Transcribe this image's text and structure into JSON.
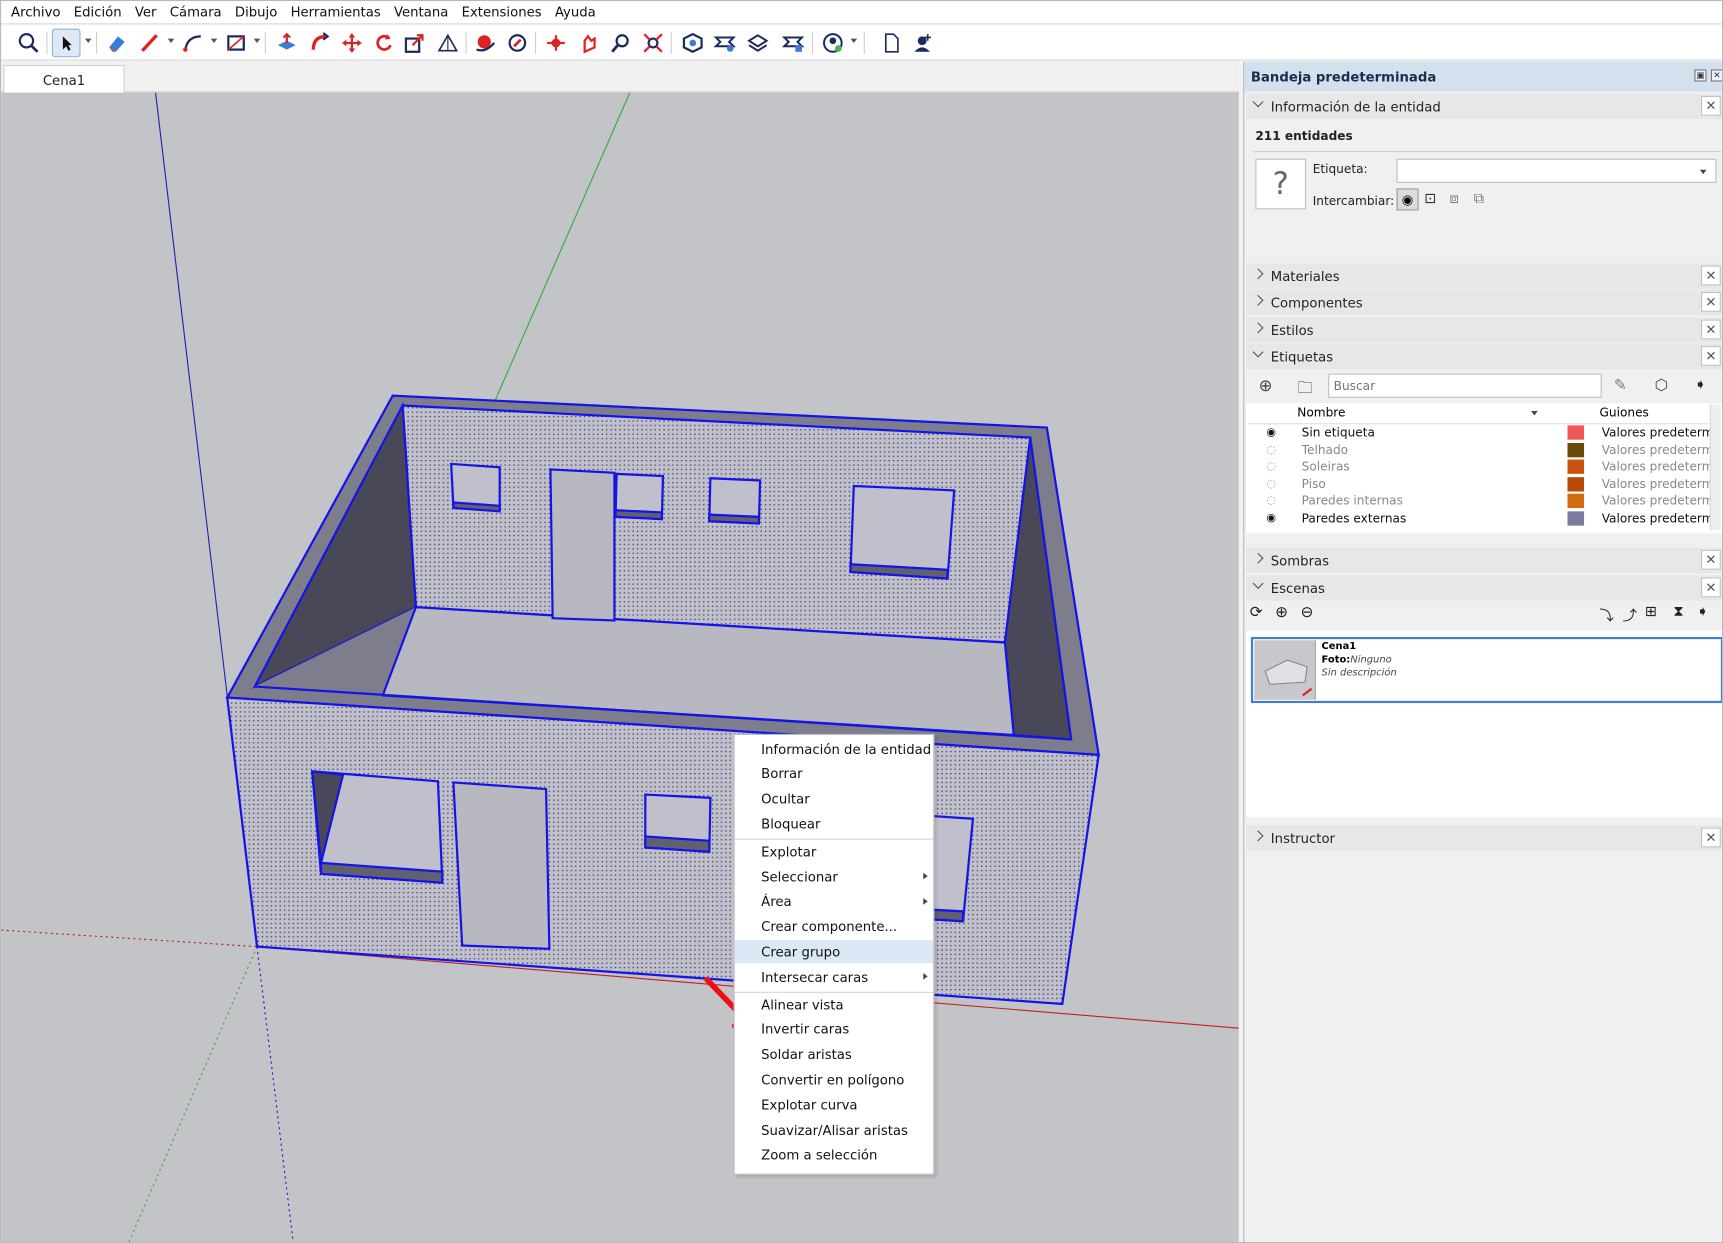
{
  "menu": [
    "Archivo",
    "Edición",
    "Ver",
    "Cámara",
    "Dibujo",
    "Herramientas",
    "Ventana",
    "Extensiones",
    "Ayuda"
  ],
  "toolbar_icons": [
    "zoom-icon",
    "select-arrow-icon",
    "eraser-icon",
    "pencil-line-icon",
    "arc-icon",
    "rectangle-icon",
    "push-pull-icon",
    "follow-me-icon",
    "move-icon",
    "rotate-icon",
    "scale-icon",
    "protractor-icon",
    "orbit-icon",
    "pan-icon",
    "zoom-window-icon",
    "zoom-extents-icon",
    "walk-icon",
    "look-around-icon",
    "section-plane-icon",
    "components-icon",
    "warehouse-icon",
    "extension-icon",
    "profile-icon",
    "new-file-icon",
    "add-user-icon"
  ],
  "scene_tab": "Cena1",
  "context_menu": {
    "items": [
      {
        "label": "Información de la entidad"
      },
      {
        "label": "Borrar"
      },
      {
        "label": "Ocultar"
      },
      {
        "label": "Bloquear"
      },
      {
        "label": "Explotar"
      },
      {
        "label": "Seleccionar",
        "submenu": true
      },
      {
        "label": "Área",
        "submenu": true
      },
      {
        "label": "Crear componente..."
      },
      {
        "label": "Crear grupo",
        "highlighted": true
      },
      {
        "label": "Intersecar caras",
        "submenu": true
      },
      {
        "label": "Alinear vista"
      },
      {
        "label": "Invertir caras"
      },
      {
        "label": "Soldar aristas"
      },
      {
        "label": "Convertir en polígono"
      },
      {
        "label": "Explotar curva"
      },
      {
        "label": "Suavizar/Alisar aristas"
      },
      {
        "label": "Zoom a selección"
      }
    ]
  },
  "tray": {
    "title": "Bandeja predeterminada",
    "entity_info": {
      "header": "Información de la entidad",
      "count": "211 entidades",
      "tag_label": "Etiqueta:",
      "toggle_label": "Intercambiar:",
      "unknown_glyph": "?"
    },
    "sections": {
      "materiales": "Materiales",
      "componentes": "Componentes",
      "estilos": "Estilos",
      "etiquetas": "Etiquetas",
      "sombras": "Sombras",
      "escenas": "Escenas",
      "instructor": "Instructor"
    },
    "tags": {
      "search_placeholder": "Buscar",
      "col_name": "Nombre",
      "col_dashes": "Guiones",
      "rows": [
        {
          "name": "Sin etiqueta",
          "visible": true,
          "color": "#f05858",
          "dashes": "Valores predeterminados"
        },
        {
          "name": "Telhado",
          "visible": false,
          "color": "#6b4a08",
          "dashes": "Valores predeterminados"
        },
        {
          "name": "Soleiras",
          "visible": false,
          "color": "#c9520c",
          "dashes": "Valores predeterminados"
        },
        {
          "name": "Piso",
          "visible": false,
          "color": "#b84808",
          "dashes": "Valores predeterminados"
        },
        {
          "name": "Paredes internas",
          "visible": false,
          "color": "#d46a10",
          "dashes": "Valores predeterminados"
        },
        {
          "name": "Paredes externas",
          "visible": true,
          "color": "#7c7aa0",
          "dashes": "Valores predeterminados"
        }
      ]
    },
    "scene": {
      "name": "Cena1",
      "photo_label": "Foto:",
      "photo_value": "Ninguno",
      "description": "Sin descripción"
    }
  },
  "colors": {
    "selection": "#1414e8",
    "accent": "#e11010",
    "panel_title": "#d3e0ee"
  }
}
